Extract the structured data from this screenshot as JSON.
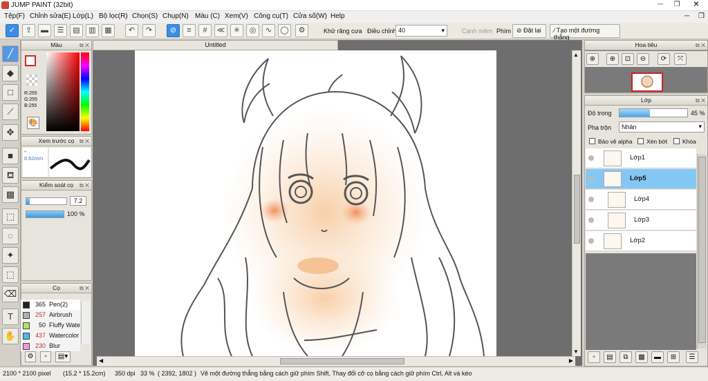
{
  "window": {
    "title": "JUMP PAINT (32bit)"
  },
  "menu": [
    "Tệp(F)",
    "Chỉnh sửa(E)",
    "Lớp(L)",
    "Bộ lọc(R)",
    "Chọn(S)",
    "Chụp(N)",
    "Màu (C)",
    "Xem(V)",
    "Công cụ(T)",
    "Cửa số(W)",
    "Help"
  ],
  "toolbar": {
    "antialias_label": "Khử răng cưa",
    "adjust_label": "Điều chỉnh",
    "adjust_value": "40",
    "edge_label": "Cạnh mềm",
    "keys_label": "Phím",
    "reset_label": "Đặt lại",
    "line_label": "Tạo một đường thẳng"
  },
  "color_panel": {
    "title": "Màu",
    "r": "R:255",
    "g": "G:255",
    "b": "B:255"
  },
  "preview_panel": {
    "title": "Xem trước cọ",
    "size": "0.52mm"
  },
  "brush_control": {
    "title": "Kiểm soát cọ",
    "size_value": "7.2",
    "opacity_value": "100 %",
    "size_fraction": 0.08,
    "opacity_fraction": 1.0
  },
  "brush_panel": {
    "title": "Cọ",
    "items": [
      {
        "size": "365",
        "name": "Pen(2)",
        "color": "#222222",
        "size_color": "#111111"
      },
      {
        "size": "257",
        "name": "Airbrush",
        "color": "#b0b0b0",
        "size_color": "#c0302a"
      },
      {
        "size": "50",
        "name": "Fluffy Wate",
        "color": "#b5e06a",
        "size_color": "#111111"
      },
      {
        "size": "437",
        "name": "Watercolor",
        "color": "#4cb8e8",
        "size_color": "#c0302a"
      },
      {
        "size": "230",
        "name": "Blur",
        "color": "#f29ad8",
        "size_color": "#c0302a"
      }
    ]
  },
  "canvas": {
    "tab_title": "Untitled"
  },
  "navigator": {
    "title": "Hoa tiêu"
  },
  "layer_panel": {
    "title": "Lớp",
    "opacity_label": "Độ trong",
    "opacity_value": "45 %",
    "opacity_fraction": 0.45,
    "blend_label": "Pha trộn",
    "blend_value": "Nhân",
    "protect_alpha": "Bảo vệ alpha",
    "clipping": "Xén bớt",
    "lock": "Khóa",
    "layers": [
      {
        "name": "Lớp1",
        "selected": false
      },
      {
        "name": "Lớp5",
        "selected": true
      },
      {
        "name": "Lớp4",
        "selected": false
      },
      {
        "name": "Lớp3",
        "selected": false
      },
      {
        "name": "Lớp2",
        "selected": false
      }
    ]
  },
  "status": {
    "size": "2100 * 2100 pixel",
    "cm": "(15.2 * 15.2cm)",
    "dpi": "350 dpi",
    "zoom": "33 %",
    "coords": "( 2392, 1802 )",
    "hint": "Vẽ một đường thẳng bằng cách giữ phím Shift, Thay đổi cỡ cọ bằng cách giữ phím Ctrl, Alt và kéo"
  },
  "colors": {
    "accent": "#3a8ee6",
    "selected_layer": "#84c7f5",
    "canvas_bg": "#6e6e6e"
  }
}
